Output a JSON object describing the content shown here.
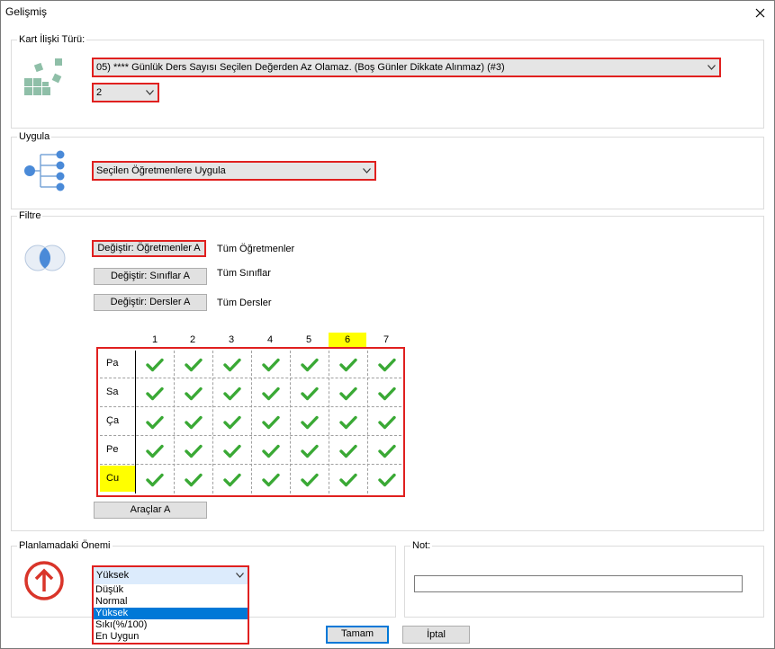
{
  "window": {
    "title": "Gelişmiş"
  },
  "kart": {
    "label": "Kart İlişki Türü:",
    "rule_value": "05) **** Günlük Ders Sayısı Seçilen Değerden Az Olamaz. (Boş Günler Dikkate Alınmaz) (#3)",
    "count_value": "2"
  },
  "uygula": {
    "label": "Uygula",
    "value": "Seçilen Öğretmenlere Uygula"
  },
  "filtre": {
    "label": "Filtre",
    "buttons": [
      {
        "label": "Değiştir: Öğretmenler A",
        "desc": "Tüm Öğretmenler"
      },
      {
        "label": "Değiştir: Sınıflar A",
        "desc": "Tüm Sınıflar"
      },
      {
        "label": "Değiştir: Dersler A",
        "desc": "Tüm Dersler"
      }
    ],
    "columns": [
      "1",
      "2",
      "3",
      "4",
      "5",
      "6",
      "7"
    ],
    "highlighted_column": "6",
    "days": [
      "Pa",
      "Sa",
      "Ça",
      "Pe",
      "Cu"
    ],
    "highlighted_day": "Cu",
    "check_color": "#3aa935",
    "tools_button": "Araçlar A"
  },
  "onem": {
    "label": "Planlamadaki Önemi",
    "selected": "Yüksek",
    "options": [
      "Düşük",
      "Normal",
      "Yüksek",
      "Sıkı(%/100)",
      "En Uygun"
    ]
  },
  "not": {
    "label": "Not:",
    "value": ""
  },
  "footer": {
    "ok": "Tamam",
    "cancel": "İptal"
  },
  "colors": {
    "accent_red": "#e0201f",
    "highlight": "#ffff00",
    "selection": "#0078d7"
  }
}
